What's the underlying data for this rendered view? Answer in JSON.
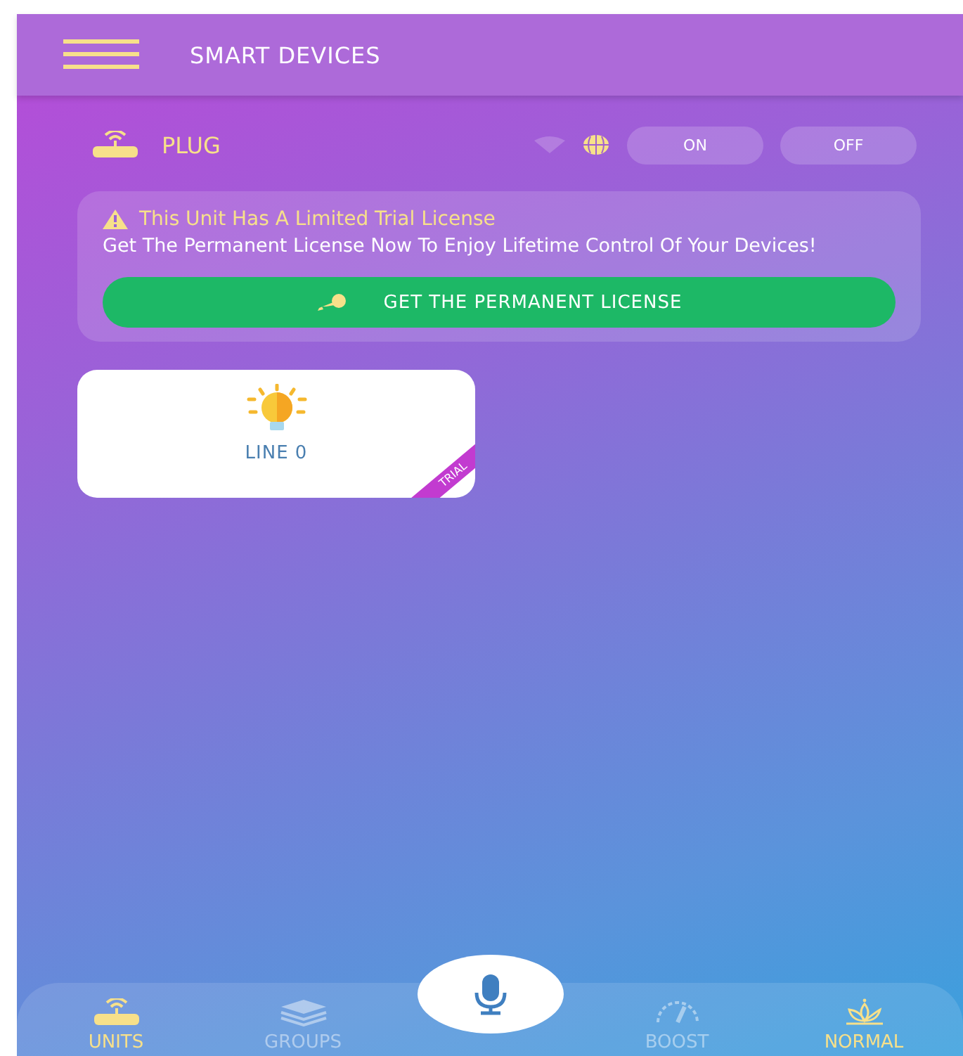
{
  "header": {
    "title": "SMART DEVICES"
  },
  "unit": {
    "name": "PLUG",
    "buttons": [
      "ON",
      "OFF"
    ]
  },
  "banner": {
    "title": "This Unit Has A Limited Trial License",
    "message": "Get The Permanent License Now To Enjoy Lifetime Control Of Your Devices!",
    "button": "GET THE PERMANENT LICENSE"
  },
  "lines": [
    {
      "label": "LINE 0",
      "ribbon": "TRIAL"
    }
  ],
  "nav": [
    {
      "kind": "units",
      "label": "UNITS",
      "selected": true
    },
    {
      "kind": "groups",
      "label": "GROUPS",
      "selected": false
    },
    {
      "kind": "mic"
    },
    {
      "kind": "boost",
      "label": "BOOST",
      "selected": false
    },
    {
      "kind": "normal",
      "label": "NORMAL",
      "selected": true
    }
  ]
}
